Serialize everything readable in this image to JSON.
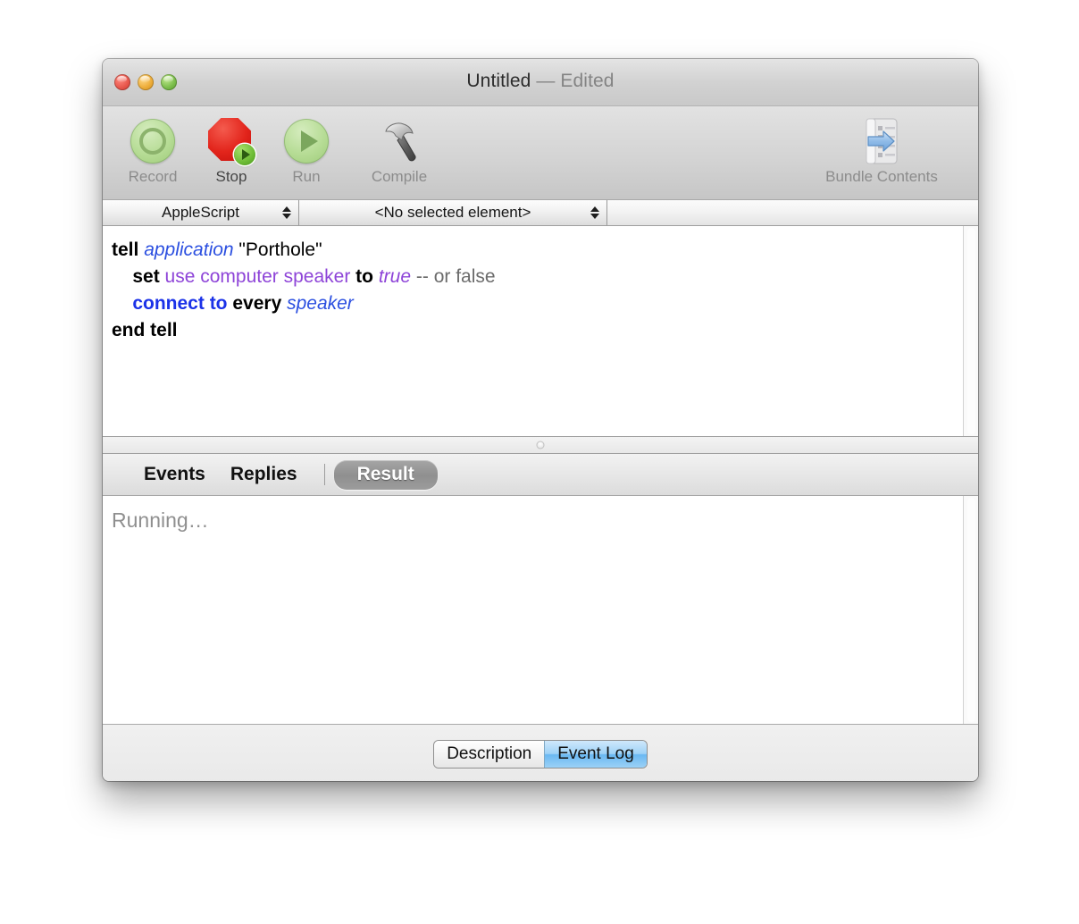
{
  "window": {
    "title_main": "Untitled",
    "title_sep": " — ",
    "title_state": "Edited",
    "traffic": {
      "close": "close-button",
      "minimize": "minimize-button",
      "zoom": "zoom-button"
    }
  },
  "toolbar": {
    "items": [
      {
        "label": "Record",
        "icon": "record-icon",
        "enabled": false
      },
      {
        "label": "Stop",
        "icon": "stop-icon",
        "enabled": true
      },
      {
        "label": "Run",
        "icon": "run-icon",
        "enabled": false
      },
      {
        "label": "Compile",
        "icon": "hammer-icon",
        "enabled": false
      }
    ],
    "bundle": {
      "label": "Bundle Contents",
      "icon": "bundle-contents-icon"
    }
  },
  "navbar": {
    "language_popup": "AppleScript",
    "element_popup": "<No selected element>"
  },
  "editor": {
    "lines": [
      {
        "tokens": [
          {
            "t": "tell",
            "c": "kw"
          },
          {
            "t": " ",
            "c": "str"
          },
          {
            "t": "application",
            "c": "cls"
          },
          {
            "t": " \"Porthole\"",
            "c": "str"
          }
        ]
      },
      {
        "tokens": [
          {
            "t": "    ",
            "c": "str"
          },
          {
            "t": "set",
            "c": "kw"
          },
          {
            "t": " ",
            "c": "str"
          },
          {
            "t": "use computer speaker",
            "c": "prop"
          },
          {
            "t": " ",
            "c": "str"
          },
          {
            "t": "to",
            "c": "kw"
          },
          {
            "t": " ",
            "c": "str"
          },
          {
            "t": "true",
            "c": "val"
          },
          {
            "t": " ",
            "c": "str"
          },
          {
            "t": "-- or false",
            "c": "cmt"
          }
        ]
      },
      {
        "tokens": [
          {
            "t": "    ",
            "c": "str"
          },
          {
            "t": "connect to",
            "c": "cmd"
          },
          {
            "t": " ",
            "c": "str"
          },
          {
            "t": "every",
            "c": "kw"
          },
          {
            "t": " ",
            "c": "str"
          },
          {
            "t": "speaker",
            "c": "cls"
          }
        ]
      },
      {
        "tokens": [
          {
            "t": "end tell",
            "c": "kw"
          }
        ]
      }
    ],
    "plain_text": "tell application \"Porthole\"\n    set use computer speaker to true -- or false\n    connect to every speaker\nend tell"
  },
  "result_tabs": {
    "items": [
      {
        "label": "Events",
        "selected": false
      },
      {
        "label": "Replies",
        "selected": false
      },
      {
        "label": "Result",
        "selected": true
      }
    ]
  },
  "result_pane": {
    "text": "Running…"
  },
  "bottom_segments": {
    "items": [
      {
        "label": "Description",
        "selected": false
      },
      {
        "label": "Event Log",
        "selected": true
      }
    ]
  },
  "colors": {
    "keyword": "#000000",
    "class_ref": "#2b4fe0",
    "property": "#8e44d8",
    "value": "#8e44d8",
    "comment": "#6b6b6b",
    "command": "#1b32e8",
    "selected_segment": "#6ab8f2",
    "selected_tab_pill": "#8f8f8f",
    "running_text": "#8f8f8f"
  }
}
